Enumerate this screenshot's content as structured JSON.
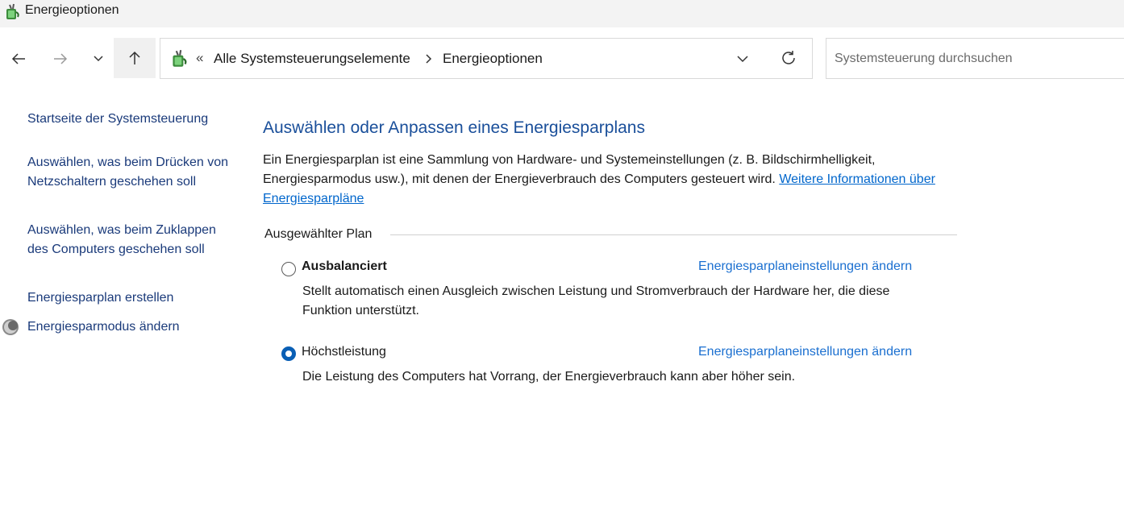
{
  "window": {
    "title": "Energieoptionen",
    "app_icon": "power-options-icon"
  },
  "nav": {
    "back_icon": "arrow-left-icon",
    "forward_icon": "arrow-right-icon",
    "recent_icon": "chevron-down-icon",
    "up_icon": "arrow-up-icon"
  },
  "address": {
    "overflow": "«",
    "crumbs": [
      "Alle Systemsteuerungselemente",
      "Energieoptionen"
    ],
    "dropdown_icon": "chevron-down-icon",
    "refresh_icon": "refresh-icon"
  },
  "search": {
    "placeholder": "Systemsteuerung durchsuchen"
  },
  "sidebar": {
    "home": "Startseite der Systemsteuerung",
    "items": [
      "Auswählen, was beim Drücken von Netzschaltern geschehen soll",
      "Auswählen, was beim Zuklappen des Computers geschehen soll",
      "Energiesparplan erstellen",
      "Energiesparmodus ändern"
    ]
  },
  "main": {
    "heading": "Auswählen oder Anpassen eines Energiesparplans",
    "description": "Ein Energiesparplan ist eine Sammlung von Hardware- und Systemeinstellungen (z. B. Bildschirmhelligkeit, Energiesparmodus usw.), mit denen der Energieverbrauch des Computers gesteuert wird. ",
    "more_link": "Weitere Informationen über Energiesparpläne",
    "group_label": "Ausgewählter Plan",
    "plans": [
      {
        "name": "Ausbalanciert",
        "selected": false,
        "link": "Energiesparplaneinstellungen ändern",
        "description": "Stellt automatisch einen Ausgleich zwischen Leistung und Stromverbrauch der Hardware her, die diese Funktion unterstützt."
      },
      {
        "name": "Höchstleistung",
        "selected": true,
        "link": "Energiesparplaneinstellungen ändern",
        "description": "Die Leistung des Computers hat Vorrang, der Energieverbrauch kann aber höher sein."
      }
    ]
  },
  "colors": {
    "heading": "#1a4f9a",
    "link": "#1a6fd0",
    "sidebar_link": "#1a3a7a",
    "radio_selected": "#0a5fb5"
  }
}
